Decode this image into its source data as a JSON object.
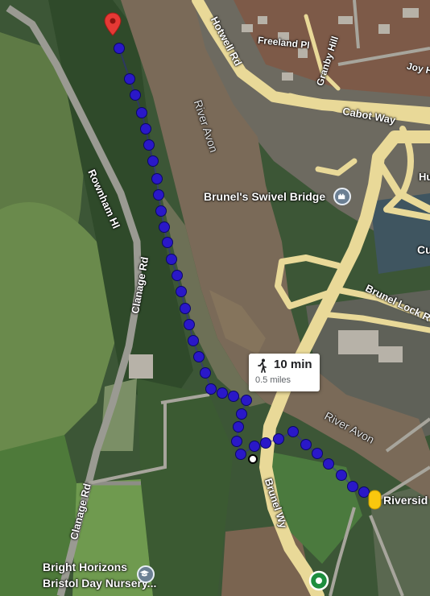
{
  "map": {
    "route": {
      "mode_icon": "walking-person-icon",
      "duration": "10 min",
      "distance": "0.5 miles",
      "route_color": "#2a18c8",
      "origin_marker_color": "#e53935",
      "destination_marker_color": "#f9c80e"
    },
    "labels": {
      "roads": [
        "Hotwell Rd",
        "Freeland Pl",
        "Granby Hill",
        "Joy H",
        "Cabot Way",
        "Rownham Hl",
        "Clanage Rd",
        "Clanage Rd",
        "Brunel Lock R",
        "Brunel Wy",
        "Cu",
        "Hu"
      ],
      "rivers": [
        "River Avon",
        "River Avon"
      ],
      "places": {
        "swivel_bridge": "Brunel's Swivel Bridge",
        "swivel_bridge_icon": "landmark-icon",
        "riverside": "Riversid",
        "nursery_line1": "Bright Horizons",
        "nursery_line2": "Bristol Day Nursery...",
        "nursery_icon": "graduation-cap-icon",
        "transit_icon": "transit-station-icon"
      }
    }
  }
}
